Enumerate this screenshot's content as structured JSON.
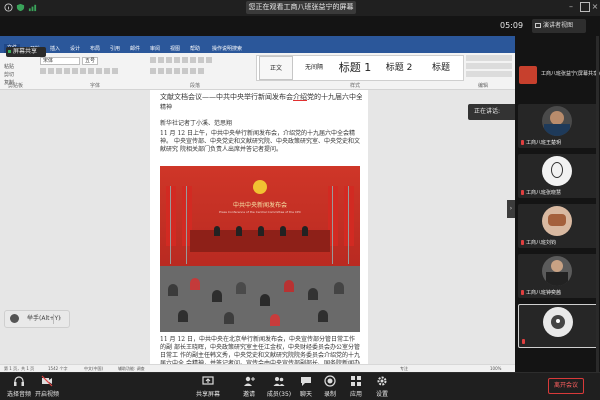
{
  "window": {
    "banner": "您正在观看工商八班张益宁的屏幕",
    "timer": "05:09",
    "speaker_view": "演讲者视图"
  },
  "overlays": {
    "sharing_tag": "屏幕共享",
    "left_tools": [
      "粘贴",
      "剪切",
      "复制",
      "格式刷"
    ],
    "speaking": "正在讲话:",
    "handup": "举手(Alt+Y)"
  },
  "word": {
    "tabs": [
      "文件",
      "开始",
      "插入",
      "设计",
      "布局",
      "引用",
      "邮件",
      "审阅",
      "视图",
      "帮助",
      "操作说明搜索"
    ],
    "font_name": "宋体",
    "font_size": "五号",
    "styles": [
      "正文",
      "无间隔",
      "标题 1",
      "标题 2",
      "标题"
    ],
    "group_labels": [
      "剪贴板",
      "字体",
      "段落",
      "样式",
      "编辑"
    ],
    "doc": {
      "heading_pre": "文献文档会议——",
      "heading_post": "中共中央举行新闻发布会",
      "heading_emph": "介绍",
      "heading_tail": "党的十九届六中全会",
      "heading_end": "精神",
      "line1": "新华社记者丁小溪、范思翔",
      "line2": "11 月 12 日上午，中共中央举行新闻发布会，介绍党的十九届六中全会精神。",
      "line3": "中央宣传部、中央党史和文献研究院、中央政策研究室、中央党史和文献研究",
      "line4": "院相关部门负责人出席并答记者提问。",
      "after1": "11 月 12 日，中共中央在北京举行新闻发布会，中央宣传部分管日常工作的副",
      "after2": "部长王晓晖，中央政策研究室主任江金权，中央财经委员会办公室分管日常工",
      "after3": "作的副主任韩文秀，中央党史和文献研究院院务委员会介绍党的十九届六中全",
      "after4": "会精神，并答记者问。宣传会由中央宣传部副部长、国务院新闻办公室主任徐"
    },
    "photo": {
      "title": "中共中央新闻发布会",
      "subtitle": "Press Conference of the Central Committee of the CPC"
    },
    "status": [
      "第 1 页，共 1 页",
      "1542 个字",
      "中文(中国)",
      "辅助功能: 调查",
      "专注",
      "100%"
    ]
  },
  "participants": [
    {
      "name": "工商八班张益宁(屏幕共享)",
      "type": "share"
    },
    {
      "name": "工商八班王楚玥",
      "avatar": "portrait-1"
    },
    {
      "name": "工商八班张晓慧",
      "avatar": "sketch-face"
    },
    {
      "name": "工商八班刘钧",
      "avatar": "food-photo"
    },
    {
      "name": "工商八班钟奕茜",
      "avatar": "person-photo"
    },
    {
      "name": "",
      "avatar": "cartoon-bird"
    }
  ],
  "toolbar": {
    "items": [
      "选择音频",
      "开启视频",
      "共享屏幕",
      "邀请",
      "成员(35)",
      "聊天",
      "录制",
      "应用",
      "设置"
    ],
    "leave": "离开会议"
  },
  "colors": {
    "word_blue": "#2b579a",
    "leave_red": "#d93a3a"
  }
}
